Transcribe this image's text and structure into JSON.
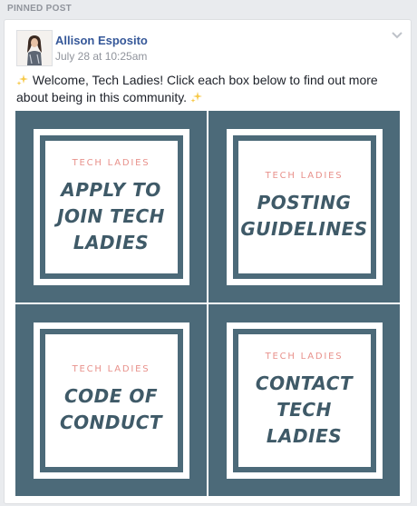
{
  "section_label": "PINNED POST",
  "post": {
    "author": "Allison Esposito",
    "timestamp": "July 28 at 10:25am",
    "text": "Welcome, Tech Ladies! Click each box below to find out more about being in this community."
  },
  "tiles": [
    {
      "kicker": "TECH LADIES",
      "title": "APPLY TO\nJOIN TECH\nLADIES"
    },
    {
      "kicker": "TECH LADIES",
      "title": "POSTING\nGUIDELINES"
    },
    {
      "kicker": "TECH LADIES",
      "title": "CODE OF\nCONDUCT"
    },
    {
      "kicker": "TECH LADIES",
      "title": "CONTACT\nTECH\nLADIES"
    }
  ],
  "colors": {
    "tile_bg": "#4c6a79",
    "tile_text": "#3f5a68",
    "kicker": "#e8918b",
    "author_link": "#365899"
  },
  "icons": [
    "sparkles-icon",
    "chevron-down-icon",
    "avatar"
  ]
}
